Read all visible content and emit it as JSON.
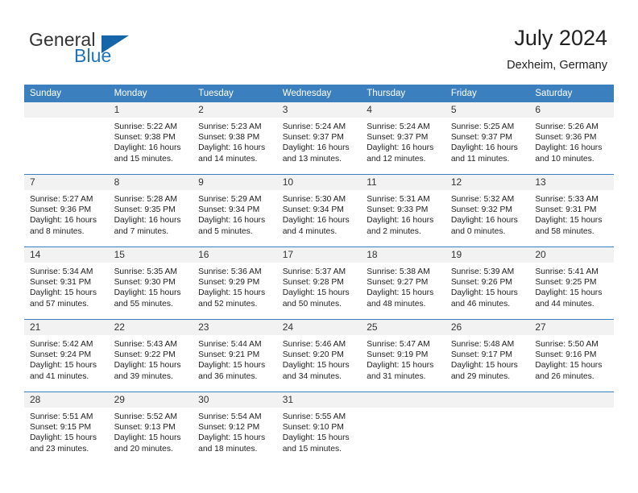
{
  "logo": {
    "word_one": "General",
    "word_two": "Blue",
    "triangle_color": "#1565a8",
    "blue_color": "#1e74bb"
  },
  "header": {
    "title": "July 2024",
    "subtitle": "Dexheim, Germany"
  },
  "calendar": {
    "header_color": "#3c7fbe",
    "daynum_bg": "#f2f2f2",
    "weekday_headers": [
      "Sunday",
      "Monday",
      "Tuesday",
      "Wednesday",
      "Thursday",
      "Friday",
      "Saturday"
    ],
    "weeks": [
      [
        {
          "day": "",
          "sunrise": "",
          "sunset": "",
          "daylight_line1": "",
          "daylight_line2": ""
        },
        {
          "day": "1",
          "sunrise": "Sunrise: 5:22 AM",
          "sunset": "Sunset: 9:38 PM",
          "daylight_line1": "Daylight: 16 hours",
          "daylight_line2": "and 15 minutes."
        },
        {
          "day": "2",
          "sunrise": "Sunrise: 5:23 AM",
          "sunset": "Sunset: 9:38 PM",
          "daylight_line1": "Daylight: 16 hours",
          "daylight_line2": "and 14 minutes."
        },
        {
          "day": "3",
          "sunrise": "Sunrise: 5:24 AM",
          "sunset": "Sunset: 9:37 PM",
          "daylight_line1": "Daylight: 16 hours",
          "daylight_line2": "and 13 minutes."
        },
        {
          "day": "4",
          "sunrise": "Sunrise: 5:24 AM",
          "sunset": "Sunset: 9:37 PM",
          "daylight_line1": "Daylight: 16 hours",
          "daylight_line2": "and 12 minutes."
        },
        {
          "day": "5",
          "sunrise": "Sunrise: 5:25 AM",
          "sunset": "Sunset: 9:37 PM",
          "daylight_line1": "Daylight: 16 hours",
          "daylight_line2": "and 11 minutes."
        },
        {
          "day": "6",
          "sunrise": "Sunrise: 5:26 AM",
          "sunset": "Sunset: 9:36 PM",
          "daylight_line1": "Daylight: 16 hours",
          "daylight_line2": "and 10 minutes."
        }
      ],
      [
        {
          "day": "7",
          "sunrise": "Sunrise: 5:27 AM",
          "sunset": "Sunset: 9:36 PM",
          "daylight_line1": "Daylight: 16 hours",
          "daylight_line2": "and 8 minutes."
        },
        {
          "day": "8",
          "sunrise": "Sunrise: 5:28 AM",
          "sunset": "Sunset: 9:35 PM",
          "daylight_line1": "Daylight: 16 hours",
          "daylight_line2": "and 7 minutes."
        },
        {
          "day": "9",
          "sunrise": "Sunrise: 5:29 AM",
          "sunset": "Sunset: 9:34 PM",
          "daylight_line1": "Daylight: 16 hours",
          "daylight_line2": "and 5 minutes."
        },
        {
          "day": "10",
          "sunrise": "Sunrise: 5:30 AM",
          "sunset": "Sunset: 9:34 PM",
          "daylight_line1": "Daylight: 16 hours",
          "daylight_line2": "and 4 minutes."
        },
        {
          "day": "11",
          "sunrise": "Sunrise: 5:31 AM",
          "sunset": "Sunset: 9:33 PM",
          "daylight_line1": "Daylight: 16 hours",
          "daylight_line2": "and 2 minutes."
        },
        {
          "day": "12",
          "sunrise": "Sunrise: 5:32 AM",
          "sunset": "Sunset: 9:32 PM",
          "daylight_line1": "Daylight: 16 hours",
          "daylight_line2": "and 0 minutes."
        },
        {
          "day": "13",
          "sunrise": "Sunrise: 5:33 AM",
          "sunset": "Sunset: 9:31 PM",
          "daylight_line1": "Daylight: 15 hours",
          "daylight_line2": "and 58 minutes."
        }
      ],
      [
        {
          "day": "14",
          "sunrise": "Sunrise: 5:34 AM",
          "sunset": "Sunset: 9:31 PM",
          "daylight_line1": "Daylight: 15 hours",
          "daylight_line2": "and 57 minutes."
        },
        {
          "day": "15",
          "sunrise": "Sunrise: 5:35 AM",
          "sunset": "Sunset: 9:30 PM",
          "daylight_line1": "Daylight: 15 hours",
          "daylight_line2": "and 55 minutes."
        },
        {
          "day": "16",
          "sunrise": "Sunrise: 5:36 AM",
          "sunset": "Sunset: 9:29 PM",
          "daylight_line1": "Daylight: 15 hours",
          "daylight_line2": "and 52 minutes."
        },
        {
          "day": "17",
          "sunrise": "Sunrise: 5:37 AM",
          "sunset": "Sunset: 9:28 PM",
          "daylight_line1": "Daylight: 15 hours",
          "daylight_line2": "and 50 minutes."
        },
        {
          "day": "18",
          "sunrise": "Sunrise: 5:38 AM",
          "sunset": "Sunset: 9:27 PM",
          "daylight_line1": "Daylight: 15 hours",
          "daylight_line2": "and 48 minutes."
        },
        {
          "day": "19",
          "sunrise": "Sunrise: 5:39 AM",
          "sunset": "Sunset: 9:26 PM",
          "daylight_line1": "Daylight: 15 hours",
          "daylight_line2": "and 46 minutes."
        },
        {
          "day": "20",
          "sunrise": "Sunrise: 5:41 AM",
          "sunset": "Sunset: 9:25 PM",
          "daylight_line1": "Daylight: 15 hours",
          "daylight_line2": "and 44 minutes."
        }
      ],
      [
        {
          "day": "21",
          "sunrise": "Sunrise: 5:42 AM",
          "sunset": "Sunset: 9:24 PM",
          "daylight_line1": "Daylight: 15 hours",
          "daylight_line2": "and 41 minutes."
        },
        {
          "day": "22",
          "sunrise": "Sunrise: 5:43 AM",
          "sunset": "Sunset: 9:22 PM",
          "daylight_line1": "Daylight: 15 hours",
          "daylight_line2": "and 39 minutes."
        },
        {
          "day": "23",
          "sunrise": "Sunrise: 5:44 AM",
          "sunset": "Sunset: 9:21 PM",
          "daylight_line1": "Daylight: 15 hours",
          "daylight_line2": "and 36 minutes."
        },
        {
          "day": "24",
          "sunrise": "Sunrise: 5:46 AM",
          "sunset": "Sunset: 9:20 PM",
          "daylight_line1": "Daylight: 15 hours",
          "daylight_line2": "and 34 minutes."
        },
        {
          "day": "25",
          "sunrise": "Sunrise: 5:47 AM",
          "sunset": "Sunset: 9:19 PM",
          "daylight_line1": "Daylight: 15 hours",
          "daylight_line2": "and 31 minutes."
        },
        {
          "day": "26",
          "sunrise": "Sunrise: 5:48 AM",
          "sunset": "Sunset: 9:17 PM",
          "daylight_line1": "Daylight: 15 hours",
          "daylight_line2": "and 29 minutes."
        },
        {
          "day": "27",
          "sunrise": "Sunrise: 5:50 AM",
          "sunset": "Sunset: 9:16 PM",
          "daylight_line1": "Daylight: 15 hours",
          "daylight_line2": "and 26 minutes."
        }
      ],
      [
        {
          "day": "28",
          "sunrise": "Sunrise: 5:51 AM",
          "sunset": "Sunset: 9:15 PM",
          "daylight_line1": "Daylight: 15 hours",
          "daylight_line2": "and 23 minutes."
        },
        {
          "day": "29",
          "sunrise": "Sunrise: 5:52 AM",
          "sunset": "Sunset: 9:13 PM",
          "daylight_line1": "Daylight: 15 hours",
          "daylight_line2": "and 20 minutes."
        },
        {
          "day": "30",
          "sunrise": "Sunrise: 5:54 AM",
          "sunset": "Sunset: 9:12 PM",
          "daylight_line1": "Daylight: 15 hours",
          "daylight_line2": "and 18 minutes."
        },
        {
          "day": "31",
          "sunrise": "Sunrise: 5:55 AM",
          "sunset": "Sunset: 9:10 PM",
          "daylight_line1": "Daylight: 15 hours",
          "daylight_line2": "and 15 minutes."
        },
        {
          "day": "",
          "sunrise": "",
          "sunset": "",
          "daylight_line1": "",
          "daylight_line2": ""
        },
        {
          "day": "",
          "sunrise": "",
          "sunset": "",
          "daylight_line1": "",
          "daylight_line2": ""
        },
        {
          "day": "",
          "sunrise": "",
          "sunset": "",
          "daylight_line1": "",
          "daylight_line2": ""
        }
      ]
    ]
  }
}
